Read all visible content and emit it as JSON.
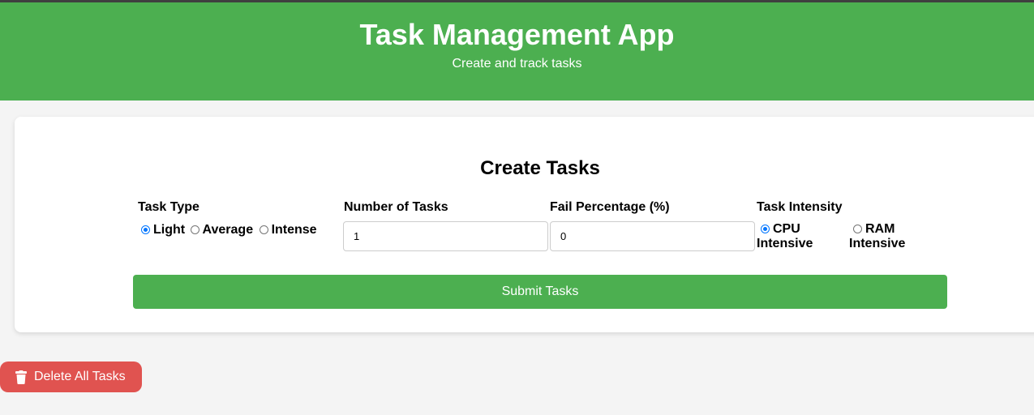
{
  "header": {
    "title": "Task Management App",
    "subtitle": "Create and track tasks"
  },
  "form": {
    "title": "Create Tasks",
    "task_type": {
      "label": "Task Type",
      "options": [
        "Light",
        "Average",
        "Intense"
      ],
      "selected": "Light"
    },
    "number_of_tasks": {
      "label": "Number of Tasks",
      "value": "1"
    },
    "fail_percentage": {
      "label": "Fail Percentage (%)",
      "value": "0"
    },
    "task_intensity": {
      "label": "Task Intensity",
      "options": [
        {
          "line1": "CPU",
          "line2": "Intensive"
        },
        {
          "line1": "RAM",
          "line2": "Intensive"
        }
      ],
      "selected": "CPU Intensive"
    },
    "submit_label": "Submit Tasks"
  },
  "actions": {
    "delete_all_label": "Delete All Tasks",
    "delete_icon": "trash-icon"
  },
  "colors": {
    "primary": "#4caf50",
    "danger": "#e05350",
    "radio_accent": "#0075ff",
    "background": "#f4f4f4"
  }
}
